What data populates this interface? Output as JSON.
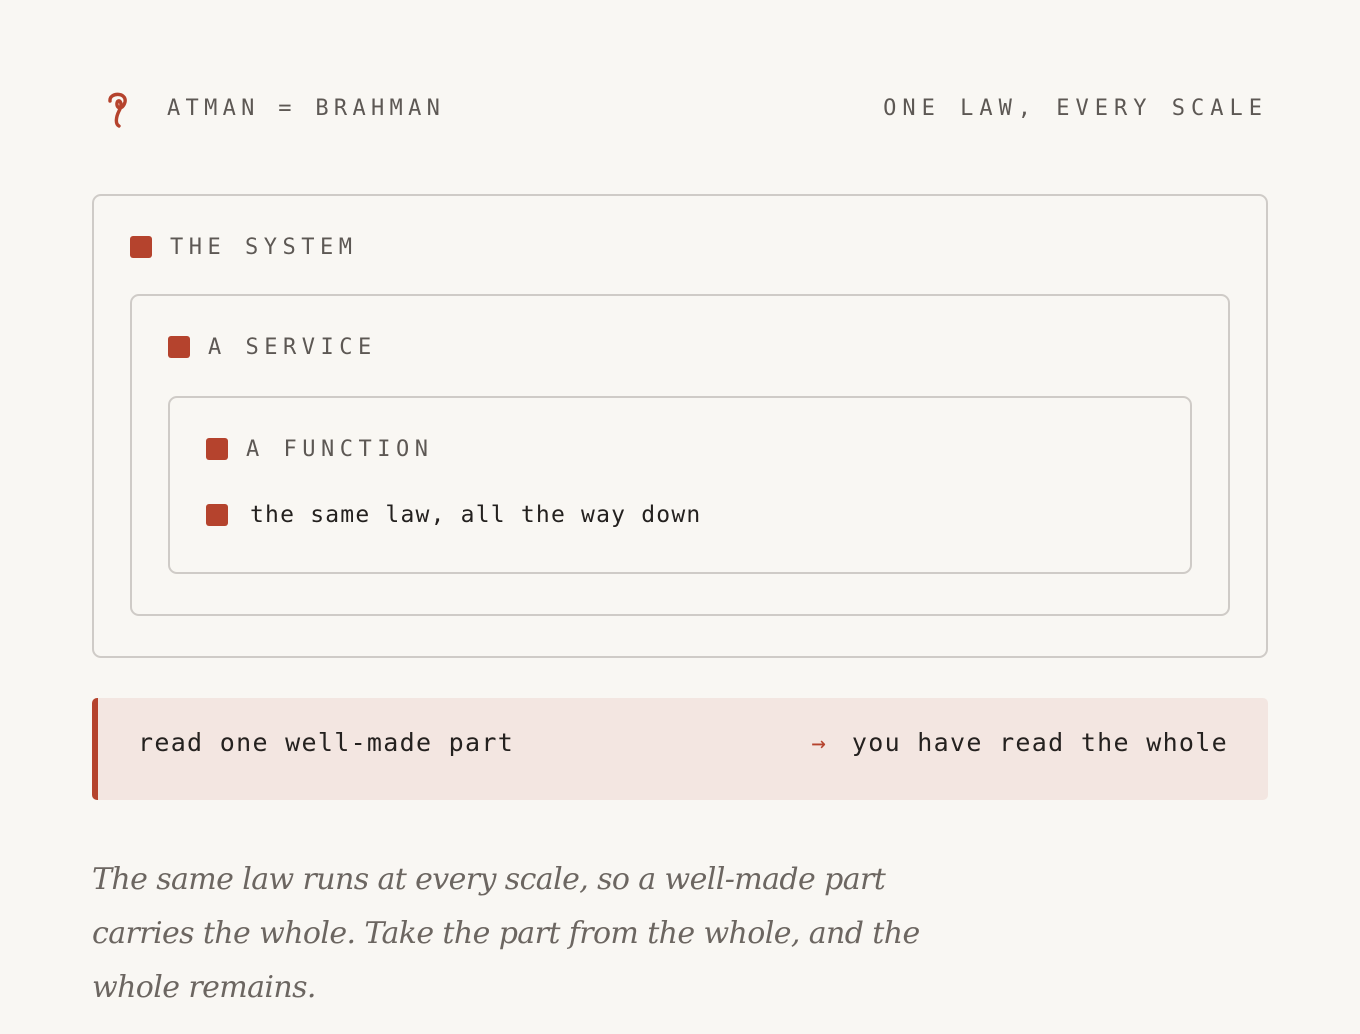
{
  "header": {
    "logo_icon": "sanskrit-glyph-icon",
    "title": "ATMAN = BRAHMAN",
    "tagline": "ONE LAW, EVERY SCALE"
  },
  "levels": {
    "system": "THE SYSTEM",
    "service": "A SERVICE",
    "function": "A FUNCTION",
    "law": "the same law, all the way down"
  },
  "callout": {
    "left": "read one well-made part",
    "arrow": "→",
    "right": "you have read the whole"
  },
  "note": "The same law runs at every scale, so a well-made part carries the whole. Take the part from the whole, and the whole remains.",
  "colors": {
    "accent": "#b5432d",
    "background": "#f9f7f3",
    "callout_bg": "#f3e6e1",
    "border": "#cfcbc7",
    "muted_text": "#5d5854"
  }
}
